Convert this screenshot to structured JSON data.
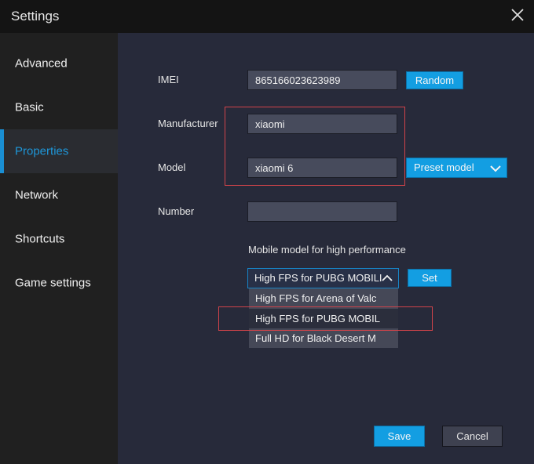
{
  "window": {
    "title": "Settings",
    "close_icon": "close-icon"
  },
  "sidebar": {
    "items": [
      {
        "label": "Advanced",
        "active": false
      },
      {
        "label": "Basic",
        "active": false
      },
      {
        "label": "Properties",
        "active": true
      },
      {
        "label": "Network",
        "active": false
      },
      {
        "label": "Shortcuts",
        "active": false
      },
      {
        "label": "Game settings",
        "active": false
      }
    ]
  },
  "properties": {
    "imei": {
      "label": "IMEI",
      "value": "865166023623989",
      "button": "Random"
    },
    "manufacturer": {
      "label": "Manufacturer",
      "value": "xiaomi"
    },
    "model": {
      "label": "Model",
      "value": "xiaomi 6",
      "button": "Preset model",
      "button_icon": "chevron-down-icon"
    },
    "number": {
      "label": "Number",
      "value": ""
    },
    "performance": {
      "label": "Mobile model for high performance",
      "selected": "High FPS for PUBG MOBILE",
      "selected_display": "High FPS for PUBG MOBILI",
      "select_icon": "chevron-up-icon",
      "set_button": "Set",
      "options": [
        "High FPS for Arena of Valc",
        "High FPS for PUBG MOBIL",
        "Full HD for Black Desert M"
      ],
      "hovered_option_index": 1
    }
  },
  "footer": {
    "save": "Save",
    "cancel": "Cancel"
  },
  "colors": {
    "accent": "#139ee2",
    "active_nav_text": "#1e96d8",
    "highlight_border": "#d1434a",
    "main_bg": "#272a3a",
    "sidebar_bg": "#202020"
  }
}
